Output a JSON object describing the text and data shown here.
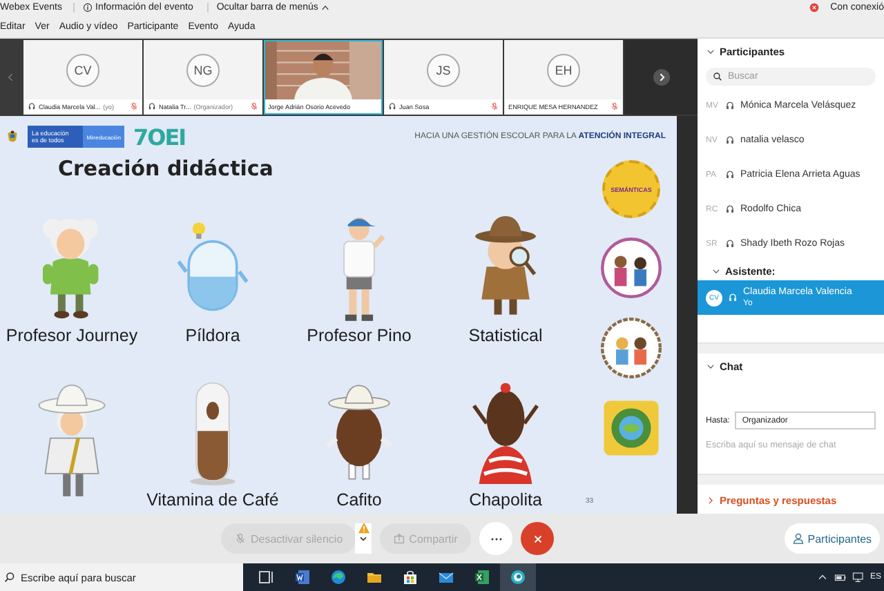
{
  "menubar": {
    "app": "Webex Events",
    "info": "Información del evento",
    "hide": "Ocultar barra de menús",
    "connection": "Con conexió",
    "menus": [
      "Editar",
      "Ver",
      "Audio y vídeo",
      "Participante",
      "Evento",
      "Ayuda"
    ]
  },
  "thumbnails": [
    {
      "kind": "avatar",
      "initials": "CV",
      "name": "Claudia Marcela Val...",
      "role": "(yo)",
      "phone": true,
      "muted": true,
      "selected": false
    },
    {
      "kind": "avatar",
      "initials": "NG",
      "name": "Natalia Tr...",
      "role": "(Organizador)",
      "phone": true,
      "muted": true,
      "selected": false
    },
    {
      "kind": "video",
      "name": "Jorge Adrián Osorio Acevedo",
      "phone": false,
      "muted": false,
      "selected": true
    },
    {
      "kind": "avatar",
      "initials": "JS",
      "name": "Juan Sosa",
      "phone": true,
      "muted": true,
      "selected": false
    },
    {
      "kind": "avatar",
      "initials": "EH",
      "name": "ENRIQUE MESA HERNANDEZ",
      "phone": false,
      "muted": true,
      "selected": false
    }
  ],
  "slide": {
    "ministry_line1": "La educación",
    "ministry_line2": "es de todos",
    "ministry": "Mineducación",
    "logo": "7OEI",
    "tagline": "HACIA UNA GESTIÓN ESCOLAR PARA LA **ATENCIÓN INTEGRAL**",
    "title": "Creación didáctica",
    "characters": [
      {
        "kind": "professor",
        "label": "Profesor Journey"
      },
      {
        "kind": "pill",
        "label": "Píldora"
      },
      {
        "kind": "hiker",
        "label": "Profesor Pino"
      },
      {
        "kind": "detective",
        "label": "Statistical"
      },
      {
        "kind": "cowboy"
      },
      {
        "kind": "capsule",
        "label": "Vitamina de Café"
      },
      {
        "kind": "bean",
        "label": "Cafito"
      },
      {
        "kind": "dancer",
        "label": "Chapolita"
      }
    ],
    "badges": [
      {
        "kind": "seal",
        "text": "SEMÁNTICAS"
      },
      {
        "kind": "family"
      },
      {
        "kind": "kids"
      },
      {
        "kind": "globe"
      }
    ],
    "page": "33"
  },
  "panel": {
    "participants": {
      "title": "Participantes",
      "expanded": true,
      "search_placeholder": "Buscar",
      "people": [
        {
          "initials": "MV",
          "name": "Mónica Marcela Velásquez",
          "selected": false
        },
        {
          "initials": "NV",
          "name": "natalia velasco",
          "selected": false
        },
        {
          "initials": "PA",
          "name": "Patricia Elena Arrieta Aguas",
          "selected": false
        },
        {
          "initials": "RC",
          "name": "Rodolfo Chica",
          "selected": false
        },
        {
          "initials": "SR",
          "name": "Shady Ibeth Rozo Rojas",
          "selected": false
        }
      ]
    },
    "attendee": {
      "title": "Asistente:",
      "expanded": true,
      "people": [
        {
          "initials": "CV",
          "name": "Claudia Marcela Valencia",
          "subtitle": "Yo",
          "selected": true
        }
      ]
    },
    "chat": {
      "title": "Chat",
      "expanded": true,
      "to_label": "Hasta:",
      "to_value": "Organizador",
      "placeholder": "Escriba aquí su mensaje de chat"
    },
    "qa": {
      "title": "Preguntas y respuestas",
      "expanded": false
    }
  },
  "controls": {
    "mute": {
      "label": "Desactivar silencio",
      "disabled": true,
      "warning": true
    },
    "share": {
      "label": "Compartir",
      "disabled": true
    },
    "participants_button": "Participantes"
  },
  "taskbar": {
    "search_placeholder": "Escribe aquí para buscar",
    "apps": [
      {
        "kind": "taskview",
        "selected": false
      },
      {
        "kind": "word",
        "selected": false
      },
      {
        "kind": "edge",
        "selected": false
      },
      {
        "kind": "folder",
        "selected": false
      },
      {
        "kind": "store",
        "selected": false
      },
      {
        "kind": "mail",
        "selected": false
      },
      {
        "kind": "excel",
        "selected": false
      },
      {
        "kind": "webex",
        "selected": true
      }
    ],
    "language": "ES"
  }
}
